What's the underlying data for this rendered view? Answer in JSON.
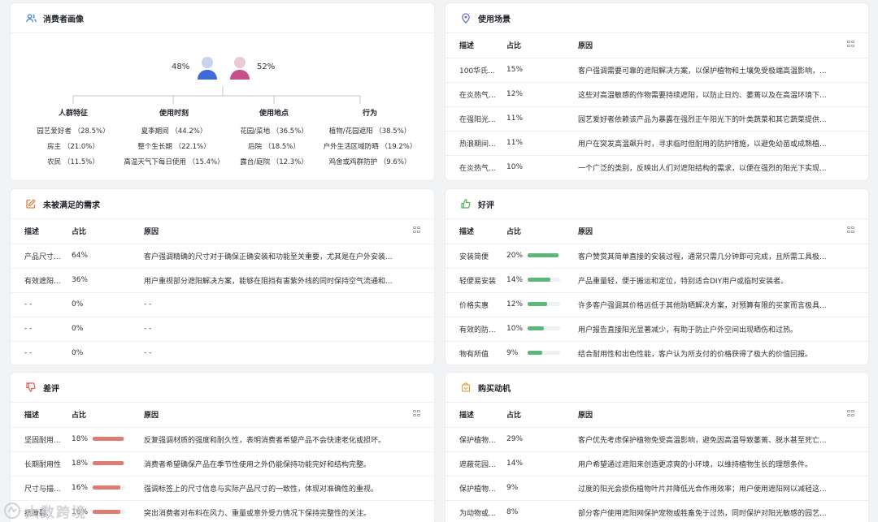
{
  "persona": {
    "title": "消费者画像",
    "female_pct": "48%",
    "male_pct": "52%",
    "columns": [
      {
        "header": "人群特征",
        "items": [
          "园艺爱好者 （28.5%）",
          "房主 （21.0%）",
          "农民 （11.5%）"
        ]
      },
      {
        "header": "使用时刻",
        "items": [
          "夏季期间 （44.2%）",
          "整个生长期 （22.1%）",
          "高温天气下每日使用 （15.4%）"
        ]
      },
      {
        "header": "使用地点",
        "items": [
          "花园/菜地 （36.5%）",
          "后院 （18.5%）",
          "露台/庭院 （12.3%）"
        ]
      },
      {
        "header": "行为",
        "items": [
          "植物/花园遮阳 （38.5%）",
          "户外生活区域防晒 （19.2%）",
          "鸡舍或鸡群防护 （9.6%）"
        ]
      }
    ]
  },
  "headers": {
    "desc": "描述",
    "pct": "占比",
    "reason": "原因"
  },
  "scenes": {
    "title": "使用场景",
    "rows": [
      {
        "desc": "100华氏...",
        "pct": "15%",
        "reason": "客户强调需要可靠的遮阳解决方案，以保护植物和土壤免受极端高温影响，..."
      },
      {
        "desc": "在炎热气...",
        "pct": "12%",
        "reason": "这些对高温敏感的作物需要持续遮阳，以防止日灼、萎蔫以及在高温环境下..."
      },
      {
        "desc": "在强阳光...",
        "pct": "11%",
        "reason": "园艺爱好者依赖该产品为暴露在强烈正午阳光下的叶类蔬菜和其它蔬菜提供..."
      },
      {
        "desc": "热浪期间...",
        "pct": "11%",
        "reason": "用户在突发高温飙升时，寻求临时但耐用的防护措施，以避免幼苗或成熟植..."
      },
      {
        "desc": "在炎热气...",
        "pct": "10%",
        "reason": "一个广泛的类别，反映出人们对遮阳结构的需求，以便在强烈的阳光下实现..."
      }
    ]
  },
  "unmet": {
    "title": "未被满足的需求",
    "rows": [
      {
        "desc": "产品尺寸...",
        "pct": "64%",
        "reason": "客户强调精确的尺寸对于确保正确安装和功能至关重要，尤其是在户外安装..."
      },
      {
        "desc": "有效遮阳...",
        "pct": "36%",
        "reason": "用户重视部分遮阳解决方案，能够在阻挡有害紫外线的同时保持空气流通和..."
      },
      {
        "desc": "- -",
        "pct": "0%",
        "reason": "- -"
      },
      {
        "desc": "- -",
        "pct": "0%",
        "reason": "- -"
      },
      {
        "desc": "- -",
        "pct": "0%",
        "reason": "- -"
      }
    ]
  },
  "positive": {
    "title": "好评",
    "bar_color": "#5cb87a",
    "rows": [
      {
        "desc": "安装简便",
        "pct": "20%",
        "level": 0.95,
        "reason": "客户赞赏其简单直接的安装过程，通常只需几分钟即可完成，且所需工具极..."
      },
      {
        "desc": "轻便易安装",
        "pct": "14%",
        "level": 0.7,
        "reason": "产品重量轻，便于搬运和定位，特别适合DIY用户或临时安装者。"
      },
      {
        "desc": "价格实惠",
        "pct": "12%",
        "level": 0.6,
        "reason": "许多客户强调其价格远低于其他防晒解决方案，对预算有限的买家而言极具..."
      },
      {
        "desc": "有效的防...",
        "pct": "10%",
        "level": 0.5,
        "reason": "用户报告直接阳光显著减少，有助于防止户外空间出现晒伤和过热。"
      },
      {
        "desc": "物有所值",
        "pct": "9%",
        "level": 0.45,
        "reason": "结合耐用性和出色性能，客户认为所支付的价格获得了极大的价值回报。"
      }
    ]
  },
  "negative": {
    "title": "差评",
    "bar_color": "#e07b73",
    "rows": [
      {
        "desc": "坚固耐用...",
        "pct": "18%",
        "level": 0.95,
        "reason": "反复强调材质的强度和耐久性，表明消费者希望产品不会快速老化或损坏。"
      },
      {
        "desc": "长期耐用性",
        "pct": "18%",
        "level": 0.95,
        "reason": "消费者希望确保产品在季节性使用之外仍能保持功能完好和结构完整。"
      },
      {
        "desc": "尺寸与描...",
        "pct": "16%",
        "level": 0.85,
        "reason": "强调标签上的尺寸信息与实际产品尺寸的一致性，体现对准确性的重视。"
      },
      {
        "desc": "抗撕裂.",
        "pct": "16%",
        "level": 0.85,
        "reason": "突出消费者对布料在风力、重量或意外受力情况下保持完整性的关注。"
      }
    ]
  },
  "motive": {
    "title": "购买动机",
    "rows": [
      {
        "desc": "保护植物...",
        "pct": "29%",
        "reason": "客户优先考虑保护植物免受高温影响，避免因高温导致萎蔫、脱水甚至死亡..."
      },
      {
        "desc": "遮蔽花园...",
        "pct": "14%",
        "reason": "用户希望通过遮阳来创造更凉爽的小环境，以维持植物生长的理想条件。"
      },
      {
        "desc": "保护植物...",
        "pct": "9%",
        "reason": "过度的阳光会损伤植物叶片并降低光合作用效率；用户使用遮阳网以减轻这..."
      },
      {
        "desc": "为动物或...",
        "pct": "8%",
        "reason": "部分客户使用遮阳网保护宠物或牲畜免于过热，同时保护对阳光敏感的园艺..."
      }
    ]
  },
  "watermark": "大数跨境"
}
